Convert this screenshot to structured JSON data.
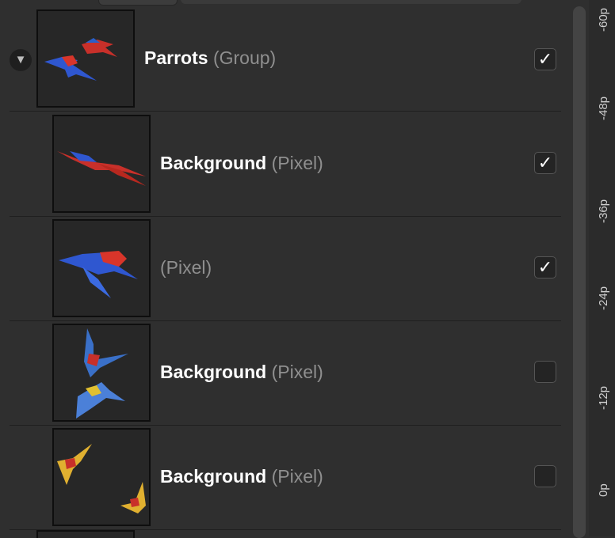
{
  "layers": [
    {
      "name": "Parrots",
      "type": "(Group)",
      "checked": true
    },
    {
      "name": "Background",
      "type": "(Pixel)",
      "checked": true
    },
    {
      "name": "",
      "type": "(Pixel)",
      "checked": true
    },
    {
      "name": "Background",
      "type": "(Pixel)",
      "checked": false
    },
    {
      "name": "Background",
      "type": "(Pixel)",
      "checked": false
    }
  ],
  "checkmark": "✓",
  "disclosure_icon": "▼",
  "ruler": [
    "-60p",
    "-48p",
    "-36p",
    "-24p",
    "-12p",
    "0p"
  ]
}
